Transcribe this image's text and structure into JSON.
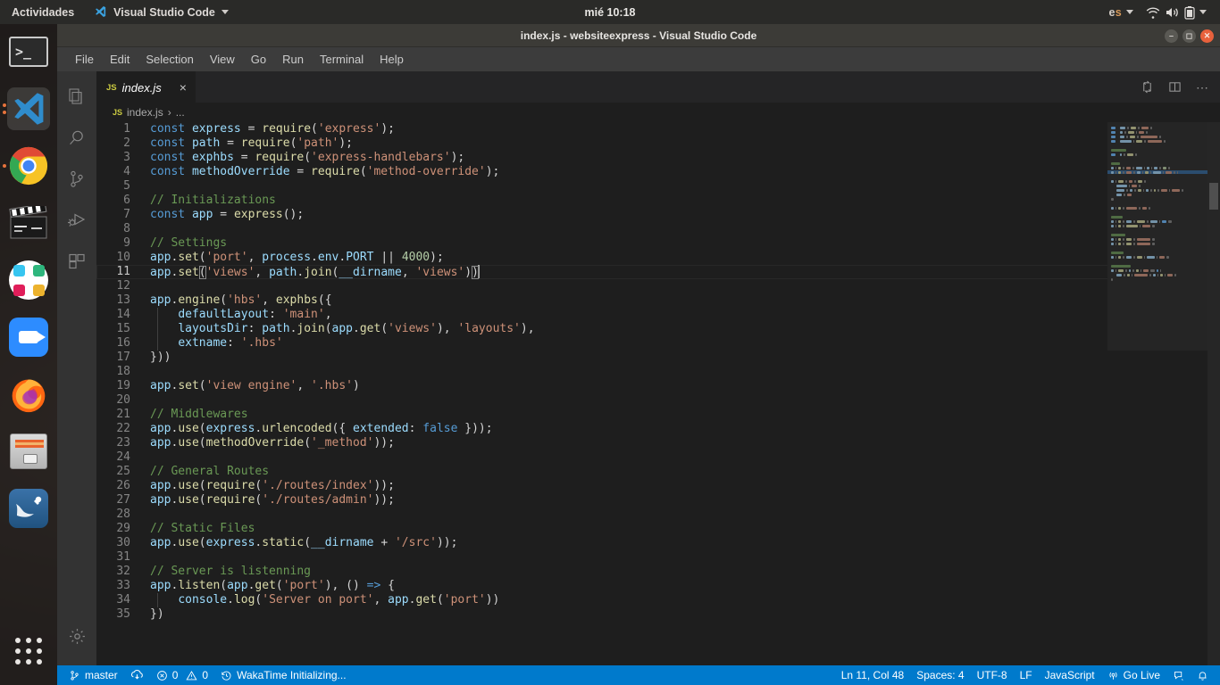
{
  "desktop": {
    "topbar": {
      "activities": "Actividades",
      "app_name": "Visual Studio Code",
      "clock": "mié 10:18",
      "keyboard_layout": "es",
      "icons": [
        "wifi-icon",
        "volume-icon",
        "battery-icon",
        "chevron-down-icon"
      ]
    },
    "dock": {
      "items": [
        {
          "name": "terminal",
          "label": "Terminal",
          "running": false
        },
        {
          "name": "visual-studio-code",
          "label": "Visual Studio Code",
          "running": true,
          "focused": true
        },
        {
          "name": "google-chrome",
          "label": "Google Chrome",
          "running": true
        },
        {
          "name": "video-editor",
          "label": "Video Editor",
          "running": false
        },
        {
          "name": "slack",
          "label": "Slack",
          "running": false
        },
        {
          "name": "zoom",
          "label": "Zoom",
          "running": false
        },
        {
          "name": "firefox",
          "label": "Firefox",
          "running": false
        },
        {
          "name": "files",
          "label": "Files",
          "running": false
        },
        {
          "name": "mysql-workbench",
          "label": "MySQL Workbench",
          "running": false
        }
      ],
      "show_applications": "Mostrar aplicaciones"
    }
  },
  "vscode": {
    "window_title": "index.js - websiteexpress - Visual Studio Code",
    "window_controls": [
      "minimize",
      "maximize",
      "close"
    ],
    "menu": [
      "File",
      "Edit",
      "Selection",
      "View",
      "Go",
      "Run",
      "Terminal",
      "Help"
    ],
    "activity_bar": [
      {
        "name": "explorer",
        "label": "Explorer",
        "icon": "files-icon",
        "active": false
      },
      {
        "name": "search",
        "label": "Search",
        "icon": "search-icon",
        "active": false
      },
      {
        "name": "source-control",
        "label": "Source Control",
        "icon": "source-control-icon",
        "active": false
      },
      {
        "name": "run-debug",
        "label": "Run and Debug",
        "icon": "run-debug-icon",
        "active": false
      },
      {
        "name": "extensions",
        "label": "Extensions",
        "icon": "extensions-icon",
        "active": false
      },
      {
        "name": "manage",
        "label": "Manage",
        "icon": "gear-icon",
        "active": false
      }
    ],
    "tab": {
      "file_icon": "JS",
      "name": "index.js",
      "close": "×",
      "preview": true
    },
    "editor_actions": [
      "split-editor-icon",
      "layout-icon",
      "more-actions-icon"
    ],
    "breadcrumb": {
      "file_icon": "JS",
      "file": "index.js",
      "separator": "›",
      "more": "..."
    },
    "code_lines": [
      {
        "n": "1",
        "tokens": [
          [
            "k",
            "const"
          ],
          [
            "op",
            " "
          ],
          [
            "vr",
            "express"
          ],
          [
            "op",
            " = "
          ],
          [
            "fn",
            "require"
          ],
          [
            "op",
            "("
          ],
          [
            "st",
            "'express'"
          ],
          [
            "op",
            ");"
          ]
        ]
      },
      {
        "n": "2",
        "tokens": [
          [
            "k",
            "const"
          ],
          [
            "op",
            " "
          ],
          [
            "vr",
            "path"
          ],
          [
            "op",
            " = "
          ],
          [
            "fn",
            "require"
          ],
          [
            "op",
            "("
          ],
          [
            "st",
            "'path'"
          ],
          [
            "op",
            ");"
          ]
        ]
      },
      {
        "n": "3",
        "tokens": [
          [
            "k",
            "const"
          ],
          [
            "op",
            " "
          ],
          [
            "vr",
            "exphbs"
          ],
          [
            "op",
            " = "
          ],
          [
            "fn",
            "require"
          ],
          [
            "op",
            "("
          ],
          [
            "st",
            "'express-handlebars'"
          ],
          [
            "op",
            ");"
          ]
        ]
      },
      {
        "n": "4",
        "tokens": [
          [
            "k",
            "const"
          ],
          [
            "op",
            " "
          ],
          [
            "vr",
            "methodOverride"
          ],
          [
            "op",
            " = "
          ],
          [
            "fn",
            "require"
          ],
          [
            "op",
            "("
          ],
          [
            "st",
            "'method-override'"
          ],
          [
            "op",
            ");"
          ]
        ]
      },
      {
        "n": "5",
        "tokens": []
      },
      {
        "n": "6",
        "tokens": [
          [
            "cm",
            "// Initializations"
          ]
        ]
      },
      {
        "n": "7",
        "tokens": [
          [
            "k",
            "const"
          ],
          [
            "op",
            " "
          ],
          [
            "vr",
            "app"
          ],
          [
            "op",
            " = "
          ],
          [
            "fn",
            "express"
          ],
          [
            "op",
            "();"
          ]
        ]
      },
      {
        "n": "8",
        "tokens": []
      },
      {
        "n": "9",
        "tokens": [
          [
            "cm",
            "// Settings"
          ]
        ]
      },
      {
        "n": "10",
        "tokens": [
          [
            "vr",
            "app"
          ],
          [
            "op",
            "."
          ],
          [
            "fn",
            "set"
          ],
          [
            "op",
            "("
          ],
          [
            "st",
            "'port'"
          ],
          [
            "op",
            ", "
          ],
          [
            "vr",
            "process"
          ],
          [
            "op",
            "."
          ],
          [
            "vr",
            "env"
          ],
          [
            "op",
            "."
          ],
          [
            "vr",
            "PORT"
          ],
          [
            "op",
            " || "
          ],
          [
            "nu",
            "4000"
          ],
          [
            "op",
            ");"
          ]
        ]
      },
      {
        "n": "11",
        "tokens": [
          [
            "vr",
            "app"
          ],
          [
            "op",
            "."
          ],
          [
            "fn",
            "set"
          ],
          [
            "bk",
            "("
          ],
          [
            "st",
            "'views'"
          ],
          [
            "op",
            ", "
          ],
          [
            "vr",
            "path"
          ],
          [
            "op",
            "."
          ],
          [
            "fn",
            "join"
          ],
          [
            "op",
            "("
          ],
          [
            "vr",
            "__dirname"
          ],
          [
            "op",
            ", "
          ],
          [
            "st",
            "'views'"
          ],
          [
            "op",
            ")"
          ],
          [
            "bk",
            ")"
          ]
        ],
        "active": true,
        "cursor": true
      },
      {
        "n": "12",
        "tokens": []
      },
      {
        "n": "13",
        "tokens": [
          [
            "vr",
            "app"
          ],
          [
            "op",
            "."
          ],
          [
            "fn",
            "engine"
          ],
          [
            "op",
            "("
          ],
          [
            "st",
            "'hbs'"
          ],
          [
            "op",
            ", "
          ],
          [
            "fn",
            "exphbs"
          ],
          [
            "op",
            "({"
          ]
        ]
      },
      {
        "n": "14",
        "tokens": [
          [
            "op",
            "    "
          ],
          [
            "vr",
            "defaultLayout"
          ],
          [
            "op",
            ": "
          ],
          [
            "st",
            "'main'"
          ],
          [
            "op",
            ","
          ]
        ],
        "indent": 1
      },
      {
        "n": "15",
        "tokens": [
          [
            "op",
            "    "
          ],
          [
            "vr",
            "layoutsDir"
          ],
          [
            "op",
            ": "
          ],
          [
            "vr",
            "path"
          ],
          [
            "op",
            "."
          ],
          [
            "fn",
            "join"
          ],
          [
            "op",
            "("
          ],
          [
            "vr",
            "app"
          ],
          [
            "op",
            "."
          ],
          [
            "fn",
            "get"
          ],
          [
            "op",
            "("
          ],
          [
            "st",
            "'views'"
          ],
          [
            "op",
            "), "
          ],
          [
            "st",
            "'layouts'"
          ],
          [
            "op",
            "),"
          ]
        ],
        "indent": 1
      },
      {
        "n": "16",
        "tokens": [
          [
            "op",
            "    "
          ],
          [
            "vr",
            "extname"
          ],
          [
            "op",
            ": "
          ],
          [
            "st",
            "'.hbs'"
          ]
        ],
        "indent": 1
      },
      {
        "n": "17",
        "tokens": [
          [
            "op",
            "}))"
          ]
        ]
      },
      {
        "n": "18",
        "tokens": []
      },
      {
        "n": "19",
        "tokens": [
          [
            "vr",
            "app"
          ],
          [
            "op",
            "."
          ],
          [
            "fn",
            "set"
          ],
          [
            "op",
            "("
          ],
          [
            "st",
            "'view engine'"
          ],
          [
            "op",
            ", "
          ],
          [
            "st",
            "'.hbs'"
          ],
          [
            "op",
            ")"
          ]
        ]
      },
      {
        "n": "20",
        "tokens": []
      },
      {
        "n": "21",
        "tokens": [
          [
            "cm",
            "// Middlewares"
          ]
        ]
      },
      {
        "n": "22",
        "tokens": [
          [
            "vr",
            "app"
          ],
          [
            "op",
            "."
          ],
          [
            "fn",
            "use"
          ],
          [
            "op",
            "("
          ],
          [
            "vr",
            "express"
          ],
          [
            "op",
            "."
          ],
          [
            "fn",
            "urlencoded"
          ],
          [
            "op",
            "({ "
          ],
          [
            "vr",
            "extended"
          ],
          [
            "op",
            ": "
          ],
          [
            "pk",
            "false"
          ],
          [
            "op",
            " }));"
          ]
        ]
      },
      {
        "n": "23",
        "tokens": [
          [
            "vr",
            "app"
          ],
          [
            "op",
            "."
          ],
          [
            "fn",
            "use"
          ],
          [
            "op",
            "("
          ],
          [
            "fn",
            "methodOverride"
          ],
          [
            "op",
            "("
          ],
          [
            "st",
            "'_method'"
          ],
          [
            "op",
            "));"
          ]
        ]
      },
      {
        "n": "24",
        "tokens": []
      },
      {
        "n": "25",
        "tokens": [
          [
            "cm",
            "// General Routes"
          ]
        ]
      },
      {
        "n": "26",
        "tokens": [
          [
            "vr",
            "app"
          ],
          [
            "op",
            "."
          ],
          [
            "fn",
            "use"
          ],
          [
            "op",
            "("
          ],
          [
            "fn",
            "require"
          ],
          [
            "op",
            "("
          ],
          [
            "st",
            "'./routes/index'"
          ],
          [
            "op",
            "));"
          ]
        ]
      },
      {
        "n": "27",
        "tokens": [
          [
            "vr",
            "app"
          ],
          [
            "op",
            "."
          ],
          [
            "fn",
            "use"
          ],
          [
            "op",
            "("
          ],
          [
            "fn",
            "require"
          ],
          [
            "op",
            "("
          ],
          [
            "st",
            "'./routes/admin'"
          ],
          [
            "op",
            "));"
          ]
        ]
      },
      {
        "n": "28",
        "tokens": []
      },
      {
        "n": "29",
        "tokens": [
          [
            "cm",
            "// Static Files"
          ]
        ]
      },
      {
        "n": "30",
        "tokens": [
          [
            "vr",
            "app"
          ],
          [
            "op",
            "."
          ],
          [
            "fn",
            "use"
          ],
          [
            "op",
            "("
          ],
          [
            "vr",
            "express"
          ],
          [
            "op",
            "."
          ],
          [
            "fn",
            "static"
          ],
          [
            "op",
            "("
          ],
          [
            "vr",
            "__dirname"
          ],
          [
            "op",
            " + "
          ],
          [
            "st",
            "'/src'"
          ],
          [
            "op",
            "));"
          ]
        ]
      },
      {
        "n": "31",
        "tokens": []
      },
      {
        "n": "32",
        "tokens": [
          [
            "cm",
            "// Server is listenning"
          ]
        ]
      },
      {
        "n": "33",
        "tokens": [
          [
            "vr",
            "app"
          ],
          [
            "op",
            "."
          ],
          [
            "fn",
            "listen"
          ],
          [
            "op",
            "("
          ],
          [
            "vr",
            "app"
          ],
          [
            "op",
            "."
          ],
          [
            "fn",
            "get"
          ],
          [
            "op",
            "("
          ],
          [
            "st",
            "'port'"
          ],
          [
            "op",
            "), () "
          ],
          [
            "ar",
            "=>"
          ],
          [
            "op",
            " {"
          ]
        ]
      },
      {
        "n": "34",
        "tokens": [
          [
            "op",
            "    "
          ],
          [
            "vr",
            "console"
          ],
          [
            "op",
            "."
          ],
          [
            "fn",
            "log"
          ],
          [
            "op",
            "("
          ],
          [
            "st",
            "'Server on port'"
          ],
          [
            "op",
            ", "
          ],
          [
            "vr",
            "app"
          ],
          [
            "op",
            "."
          ],
          [
            "fn",
            "get"
          ],
          [
            "op",
            "("
          ],
          [
            "st",
            "'port'"
          ],
          [
            "op",
            "))"
          ]
        ],
        "indent": 1
      },
      {
        "n": "35",
        "tokens": [
          [
            "op",
            "})"
          ]
        ]
      }
    ],
    "status_bar": {
      "left": [
        {
          "name": "branch",
          "icon": "source-control-icon",
          "label": "master"
        },
        {
          "name": "sync",
          "icon": "sync-icon",
          "label": ""
        },
        {
          "name": "problems",
          "icon": "error-warning-icon",
          "label": "0  0",
          "errors": "0",
          "warnings": "0"
        },
        {
          "name": "wakatime",
          "icon": "clock-icon",
          "label": "WakaTime Initializing..."
        }
      ],
      "right": [
        {
          "name": "cursor-position",
          "label": "Ln 11, Col 48"
        },
        {
          "name": "indentation",
          "label": "Spaces: 4"
        },
        {
          "name": "encoding",
          "label": "UTF-8"
        },
        {
          "name": "eol",
          "label": "LF"
        },
        {
          "name": "language-mode",
          "label": "JavaScript"
        },
        {
          "name": "go-live",
          "label": "Go Live",
          "icon": "broadcast-icon"
        },
        {
          "name": "feedback",
          "label": "",
          "icon": "feedback-icon"
        },
        {
          "name": "notifications",
          "label": "",
          "icon": "bell-icon"
        }
      ],
      "background_color": "#007acc"
    },
    "theme_colors": {
      "editor_background": "#1e1e1e",
      "sidebar_background": "#333333",
      "tabbar_background": "#252526",
      "statusbar_background": "#007acc",
      "titlebar_background": "#3c3b37",
      "keyword": "#569cd6",
      "variable": "#9cdcfe",
      "function": "#dcdcaa",
      "string": "#ce9178",
      "comment": "#6a9955",
      "number": "#b5cea8"
    }
  }
}
